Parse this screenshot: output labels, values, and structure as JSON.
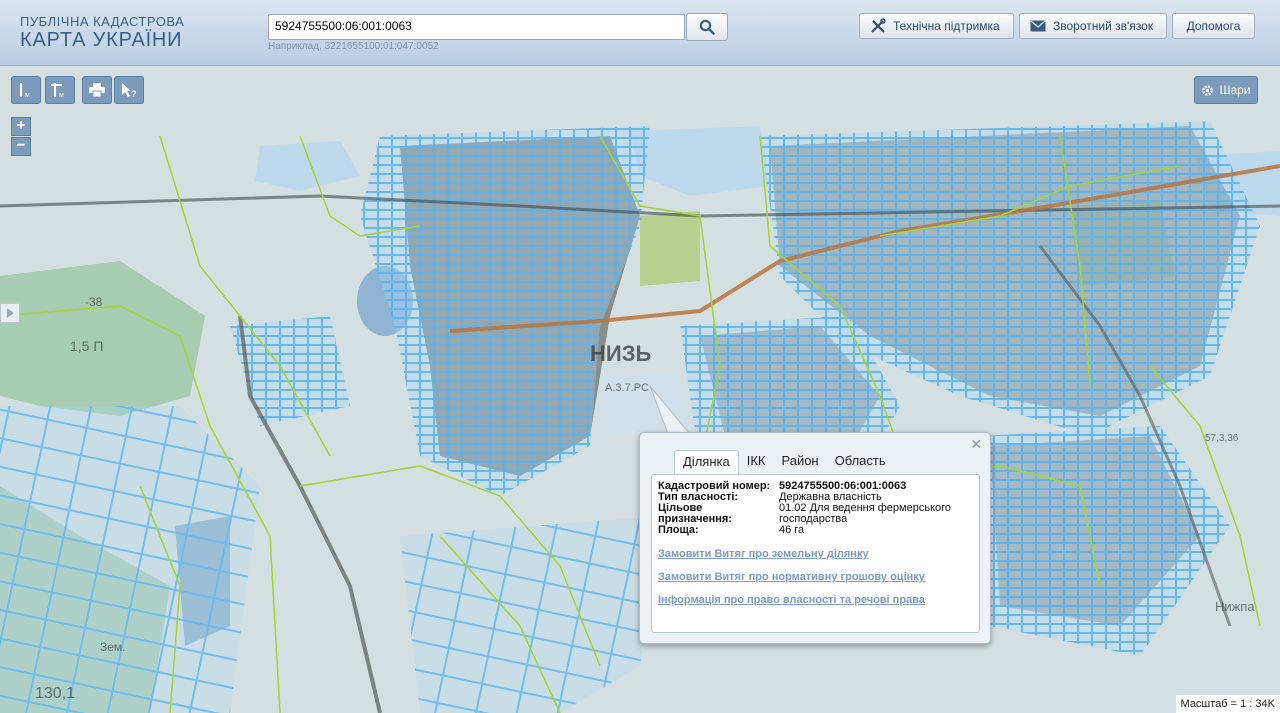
{
  "header": {
    "logo_line1": "ПУБЛІЧНА КАДАСТРОВА",
    "logo_line2": "КАРТА УКРАЇНИ",
    "search_value": "5924755500:06:001:0063",
    "search_hint": "Наприклад, 3221655100:01:047:0052",
    "buttons": {
      "support": "Технічна підтримка",
      "feedback": "Зворотний зв'язок",
      "help": "Допомога"
    }
  },
  "map": {
    "layers_label": "Шари",
    "labels": [
      "НИЗЬ",
      "А.3.7.РС",
      "1,5 П",
      "-38",
      "Зем.",
      "130,1",
      "Нижпа",
      "57,3,36"
    ],
    "scale": "Масштаб = 1 : 34K",
    "colors": {
      "parcel": "#5db4ef",
      "boundary": "#a6d33a",
      "road": "#b8743f",
      "water": "#bdd7ea",
      "forest": "#9fc9a8"
    }
  },
  "popup": {
    "tabs": [
      "Ділянка",
      "ІКК",
      "Район",
      "Область"
    ],
    "rows": [
      {
        "label": "Кадастровий номер:",
        "value": "5924755500:06:001:0063"
      },
      {
        "label": "Тип власності:",
        "value": "Державна власність"
      },
      {
        "label": "Цільове призначення:",
        "value": "01.02 Для ведення фермерського господарства"
      },
      {
        "label": "Площа:",
        "value": "46 га"
      }
    ],
    "links": [
      "Замовити Витяг про земельну ділянку",
      "Замовити Витяг про нормативну грошову оцінку",
      "Інформація про право власності та речові права"
    ]
  }
}
